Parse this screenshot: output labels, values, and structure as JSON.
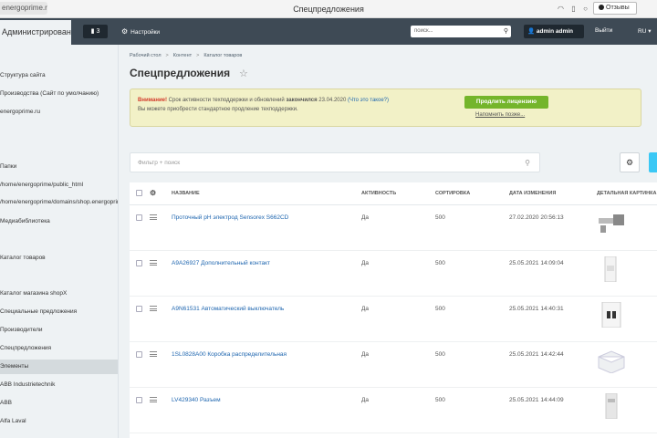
{
  "browser": {
    "url": "energoprime.ru",
    "page_title": "Спецпредложения",
    "reviews_label": "Отзывы"
  },
  "header": {
    "admin_tab": "Администрирование",
    "notifications_count": "3",
    "settings_label": "Настройки",
    "search_placeholder": "поиск...",
    "user_name": "admin admin",
    "logout_label": "Выйти",
    "lang_label": "RU"
  },
  "sidebar": {
    "items": [
      {
        "label": "Структура сайта",
        "active": false
      },
      {
        "label": "Производства (Сайт по умолчанию)",
        "active": false
      },
      {
        "label": "energoprime.ru",
        "active": false
      },
      {
        "label": "Папки",
        "active": false
      },
      {
        "label": "/home/energoprime/public_html",
        "active": false
      },
      {
        "label": "/home/energoprime/domains/shop.energoprime.ru",
        "active": false
      },
      {
        "label": "Медиабиблиотека",
        "active": false
      },
      {
        "label": "Каталог товаров",
        "active": false
      },
      {
        "label": "Каталог магазина shopX",
        "active": false
      },
      {
        "label": "Специальные предложения",
        "active": false
      },
      {
        "label": "Производители",
        "active": false
      },
      {
        "label": "Спецпредложения",
        "active": false
      },
      {
        "label": "Элементы",
        "active": true
      },
      {
        "label": "ABB Industrietechnik",
        "active": false
      },
      {
        "label": "ABB",
        "active": false
      },
      {
        "label": "Alfa Laval",
        "active": false
      }
    ]
  },
  "breadcrumb": [
    "Рабочий стол",
    "Контент",
    "Каталог товаров"
  ],
  "page_heading": "Спецпредложения",
  "notice": {
    "warning_label": "Внимание!",
    "text_part1": "Срок активности техподдержки и обновлений",
    "text_bold": "закончился",
    "date": "23.04.2020",
    "link": "(Что это такое?)",
    "line2": "Вы можете приобрести стандартное продление техподдержки.",
    "renew_button": "Продлить лицензию",
    "remind_link": "Напомнить позже..."
  },
  "filter": {
    "placeholder": "Фильтр + поиск"
  },
  "table": {
    "columns": [
      "НАЗВАНИЕ",
      "АКТИВНОСТЬ",
      "СОРТИРОВКА",
      "ДАТА ИЗМЕНЕНИЯ",
      "ДЕТАЛЬНАЯ КАРТИНКА"
    ],
    "rows": [
      {
        "name": "Проточный pH электрод Sensorex S662CD",
        "active": "Да",
        "sort": "500",
        "date": "27.02.2020 20:56:13",
        "thumb": "electrode"
      },
      {
        "name": "A9A26927 Дополнительный контакт",
        "active": "Да",
        "sort": "500",
        "date": "25.05.2021 14:09:04",
        "thumb": "contact"
      },
      {
        "name": "A9N61531 Автоматический выключатель",
        "active": "Да",
        "sort": "500",
        "date": "25.05.2021 14:40:31",
        "thumb": "breaker"
      },
      {
        "name": "1SL0828A00 Коробка распределительная",
        "active": "Да",
        "sort": "500",
        "date": "25.05.2021 14:42:44",
        "thumb": "box"
      },
      {
        "name": "LV429340 Разъем",
        "active": "Да",
        "sort": "500",
        "date": "25.05.2021 14:44:09",
        "thumb": "connector"
      }
    ]
  },
  "colors": {
    "header_bg": "#3e4a55",
    "notice_bg": "#f2f1c7",
    "renew_green": "#74b52b",
    "link_blue": "#2067b0",
    "add_button": "#3bc8f5"
  }
}
